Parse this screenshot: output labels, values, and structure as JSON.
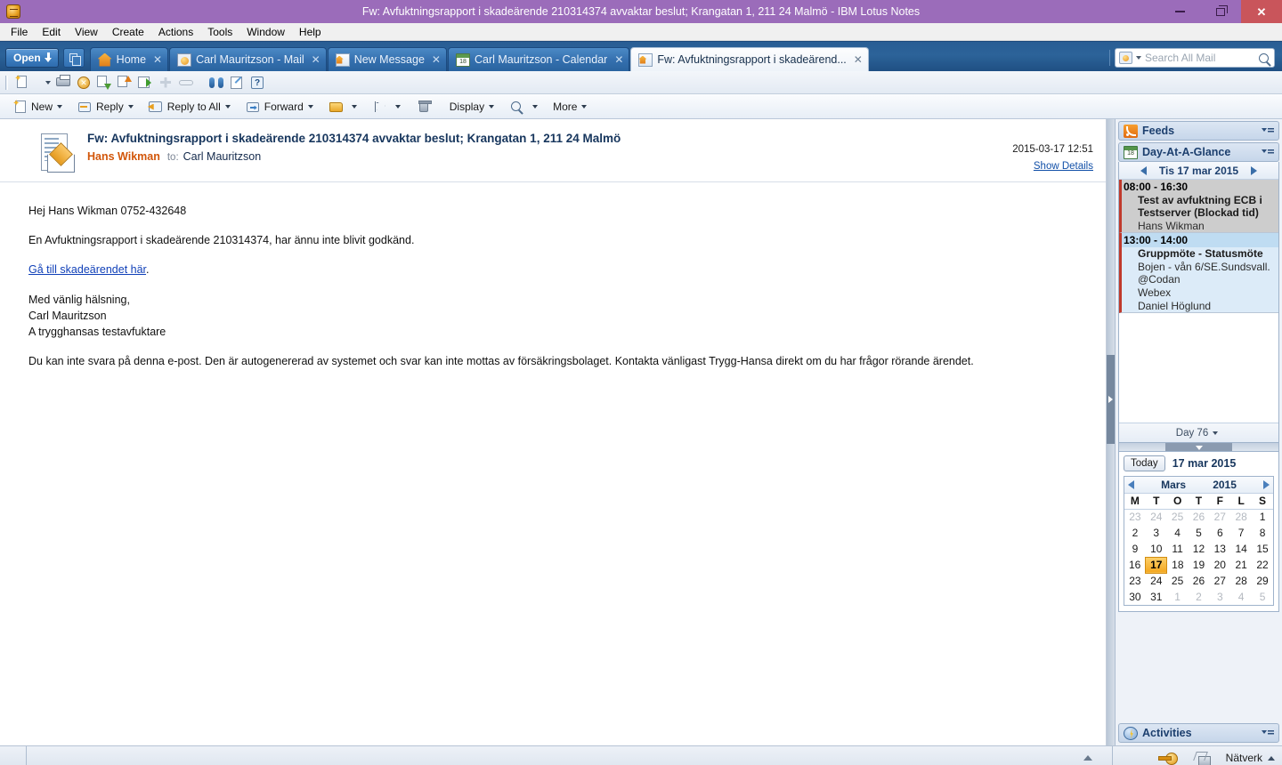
{
  "window": {
    "title": "Fw: Avfuktningsrapport i skadeärende 210314374 avvaktar beslut; Krangatan 1, 211 24 Malmö - IBM Lotus Notes",
    "app_icon": "notes-app-icon",
    "minimize_label": "Minimize",
    "restore_label": "Restore",
    "close_label": "Close",
    "titlebar_color": "#9b6cba"
  },
  "menu": {
    "items": [
      "File",
      "Edit",
      "View",
      "Create",
      "Actions",
      "Tools",
      "Window",
      "Help"
    ]
  },
  "tabbar": {
    "open_label": "Open",
    "tabs": [
      {
        "label": "Home",
        "icon": "home-icon",
        "active": false
      },
      {
        "label": "Carl Mauritzson - Mail",
        "icon": "mail-icon",
        "active": false
      },
      {
        "label": "New Message",
        "icon": "new-message-icon",
        "active": false
      },
      {
        "label": "Carl Mauritzson - Calendar",
        "icon": "calendar-icon",
        "active": false
      },
      {
        "label": "Fw: Avfuktningsrapport i skadeärend...",
        "icon": "mail-open-icon",
        "active": true
      }
    ],
    "close_glyph": "✕"
  },
  "search": {
    "placeholder": "Search All Mail",
    "scope_icon": "mail-scope-icon",
    "submit_icon": "magnifier-icon"
  },
  "toolbar": {
    "icons": [
      "new-document-icon",
      "print-icon",
      "cancel-icon",
      "move-down-icon",
      "move-up-icon",
      "folder-expand-icon",
      "add-icon",
      "link-icon",
      "find-icon",
      "edit-icon",
      "help-icon"
    ]
  },
  "actionbar": {
    "actions": [
      {
        "label": "New",
        "icon": "new-icon",
        "has_caret": true
      },
      {
        "label": "Reply",
        "icon": "reply-icon",
        "has_caret": true
      },
      {
        "label": "Reply to All",
        "icon": "reply-all-icon",
        "has_caret": true
      },
      {
        "label": "Forward",
        "icon": "forward-icon",
        "has_caret": true
      },
      {
        "label": "",
        "icon": "folder-icon",
        "has_caret": true
      },
      {
        "label": "",
        "icon": "flag-icon",
        "has_caret": true
      },
      {
        "label": "",
        "icon": "delete-icon",
        "has_caret": false
      },
      {
        "label": "Display",
        "icon": "",
        "has_caret": true
      },
      {
        "label": "",
        "icon": "search-icon",
        "has_caret": true
      },
      {
        "label": "More",
        "icon": "",
        "has_caret": true
      }
    ]
  },
  "mail": {
    "icon": "memo-envelope-icon",
    "subject": "Fw: Avfuktningsrapport i skadeärende 210314374 avvaktar beslut; Krangatan 1, 211 24 Malmö",
    "from": "Hans Wikman",
    "to_label": "to:",
    "to": "Carl Mauritzson",
    "date": "2015-03-17 12:51",
    "show_details": "Show Details",
    "body": {
      "greeting": "Hej Hans Wikman 0752-432648",
      "paragraph1": "En Avfuktningsrapport i skadeärende 210314374, har ännu inte blivit godkänd.",
      "link_text": "Gå till skadeärendet här",
      "link_suffix": ".",
      "sign_off": "Med vänlig hälsning,",
      "sign_name": "Carl Mauritzson",
      "sign_role": "A trygghansas testavfuktare",
      "disclaimer": "Du kan inte svara på denna e-post. Den är autogenererad av systemet och svar kan inte mottas av försäkringsbolaget. Kontakta vänligast Trygg-Hansa direkt om du har frågor rörande ärendet."
    }
  },
  "sidebar": {
    "feeds": {
      "title": "Feeds",
      "icon": "feeds-icon",
      "menu_icon": "panel-menu-icon"
    },
    "day_at_a_glance": {
      "title": "Day-At-A-Glance",
      "icon": "calendar-icon",
      "menu_icon": "panel-menu-icon",
      "nav_date": "Tis 17 mar 2015",
      "prev_icon": "prev-arrow-icon",
      "next_icon": "next-arrow-icon",
      "appointments": [
        {
          "time": "08:00 - 16:30",
          "title_line1": "Test av avfuktning ECB i",
          "title_line2": "Testserver (Blockad tid)",
          "detail_lines": [
            "Hans Wikman"
          ],
          "type": "blocked"
        },
        {
          "time": "13:00 - 14:00",
          "title_line1": "Gruppmöte - Statusmöte",
          "title_line2": "",
          "detail_lines": [
            "Bojen - vån 6/SE.Sundsvall.",
            "@Codan",
            "Webex",
            "Daniel Höglund"
          ],
          "type": "meeting"
        }
      ],
      "day_count": "Day 76"
    },
    "date_picker": {
      "today_label": "Today",
      "current_date": "17 mar 2015",
      "month": "Mars",
      "year": "2015",
      "prev_icon": "prev-month-icon",
      "next_icon": "next-month-icon",
      "weekday_headers": [
        "M",
        "T",
        "O",
        "T",
        "F",
        "L",
        "S"
      ],
      "weeks": [
        [
          {
            "d": "23",
            "o": true
          },
          {
            "d": "24",
            "o": true
          },
          {
            "d": "25",
            "o": true
          },
          {
            "d": "26",
            "o": true
          },
          {
            "d": "27",
            "o": true
          },
          {
            "d": "28",
            "o": true
          },
          {
            "d": "1",
            "o": false
          }
        ],
        [
          {
            "d": "2",
            "o": false
          },
          {
            "d": "3",
            "o": false
          },
          {
            "d": "4",
            "o": false
          },
          {
            "d": "5",
            "o": false
          },
          {
            "d": "6",
            "o": false
          },
          {
            "d": "7",
            "o": false
          },
          {
            "d": "8",
            "o": false
          }
        ],
        [
          {
            "d": "9",
            "o": false
          },
          {
            "d": "10",
            "o": false
          },
          {
            "d": "11",
            "o": false
          },
          {
            "d": "12",
            "o": false
          },
          {
            "d": "13",
            "o": false
          },
          {
            "d": "14",
            "o": false
          },
          {
            "d": "15",
            "o": false
          }
        ],
        [
          {
            "d": "16",
            "o": false
          },
          {
            "d": "17",
            "o": false,
            "today": true
          },
          {
            "d": "18",
            "o": false
          },
          {
            "d": "19",
            "o": false
          },
          {
            "d": "20",
            "o": false
          },
          {
            "d": "21",
            "o": false
          },
          {
            "d": "22",
            "o": false
          }
        ],
        [
          {
            "d": "23",
            "o": false
          },
          {
            "d": "24",
            "o": false
          },
          {
            "d": "25",
            "o": false
          },
          {
            "d": "26",
            "o": false
          },
          {
            "d": "27",
            "o": false
          },
          {
            "d": "28",
            "o": false
          },
          {
            "d": "29",
            "o": false
          }
        ],
        [
          {
            "d": "30",
            "o": false
          },
          {
            "d": "31",
            "o": false
          },
          {
            "d": "1",
            "o": true
          },
          {
            "d": "2",
            "o": true
          },
          {
            "d": "3",
            "o": true
          },
          {
            "d": "4",
            "o": true
          },
          {
            "d": "5",
            "o": true
          }
        ]
      ],
      "today_highlight_color": "#f3a71f"
    },
    "activities": {
      "title": "Activities",
      "icon": "activities-icon",
      "menu_icon": "panel-menu-icon"
    }
  },
  "statusbar": {
    "key_icon": "key-icon",
    "lock_icon": "lock-icon",
    "network_label": "Nätverk",
    "network_caret": "▲"
  }
}
